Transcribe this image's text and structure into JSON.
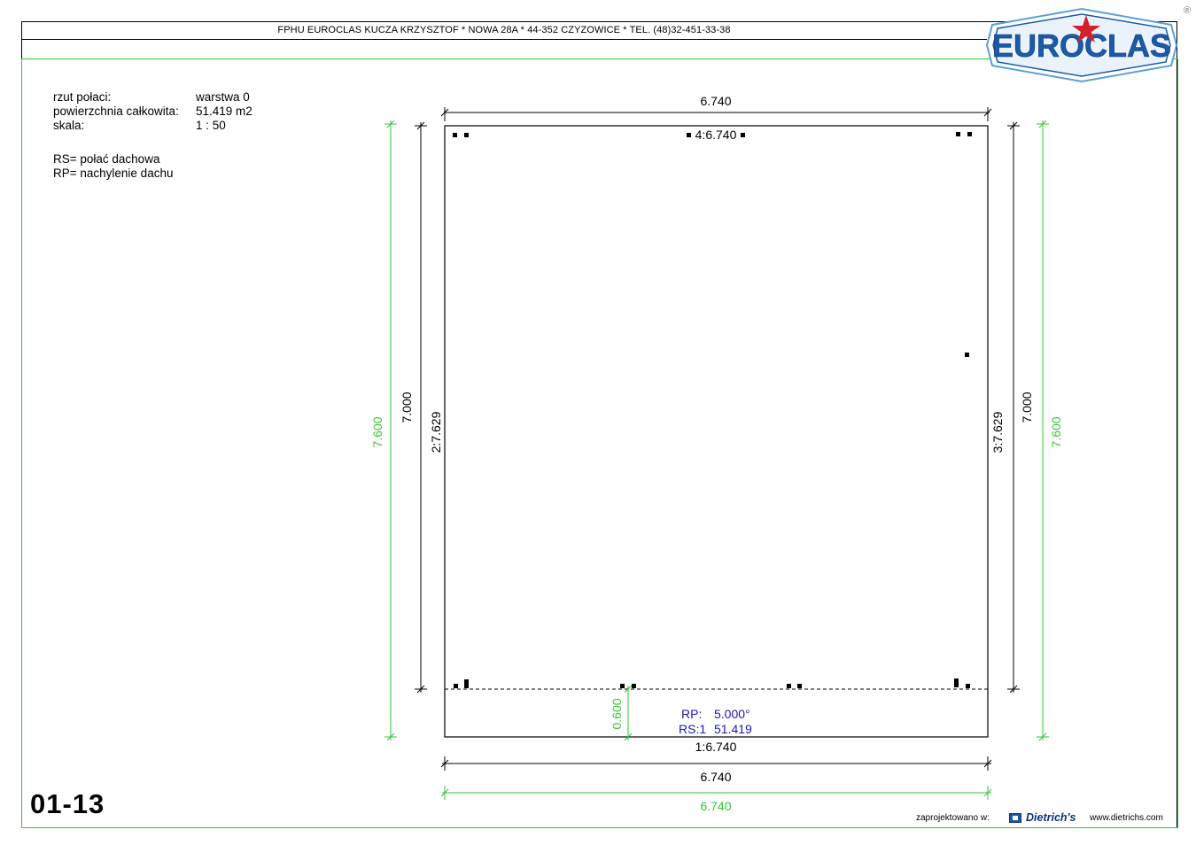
{
  "header": {
    "company_line": "FPHU EUROCLAS KUCZA KRZYSZTOF * NOWA 28A * 44-352 CZYZOWICE * TEL. (48)32-451-33-38",
    "logo_text": "EUROCLAS",
    "registered_mark": "®"
  },
  "info": {
    "rows": [
      {
        "label": "rzut połaci:",
        "value": "warstwa 0"
      },
      {
        "label": "powierzchnia całkowita:",
        "value": "51.419 m2"
      },
      {
        "label": "skala:",
        "value": "1 : 50"
      }
    ],
    "legend": [
      "RS= połać dachowa",
      "RP= nachylenie dachu"
    ]
  },
  "drawing": {
    "top_width": "6.740",
    "top_edge_label": "4:6.740",
    "bottom_edge_label": "1:6.740",
    "bottom_width_black": "6.740",
    "bottom_width_green": "6.740",
    "left_height_black": "7.000",
    "left_height_green": "7.600",
    "left_edge_label": "2:7.629",
    "right_height_black": "7.000",
    "right_height_green": "7.600",
    "right_edge_label": "3:7.629",
    "overhang": "0.600",
    "rp_label": "RP:",
    "rp_value": "5.000°",
    "rs_label": "RS:1",
    "rs_value": "51.419"
  },
  "sheet_number": "01-13",
  "footer": {
    "designed_in": "zaprojektowano w:",
    "brand": "Dietrich's",
    "url": "www.dietrichs.com"
  },
  "colors": {
    "green": "#36c436",
    "blue": "#1a1ab4",
    "logo_blue": "#1c5aa8",
    "logo_red": "#d3202a"
  }
}
